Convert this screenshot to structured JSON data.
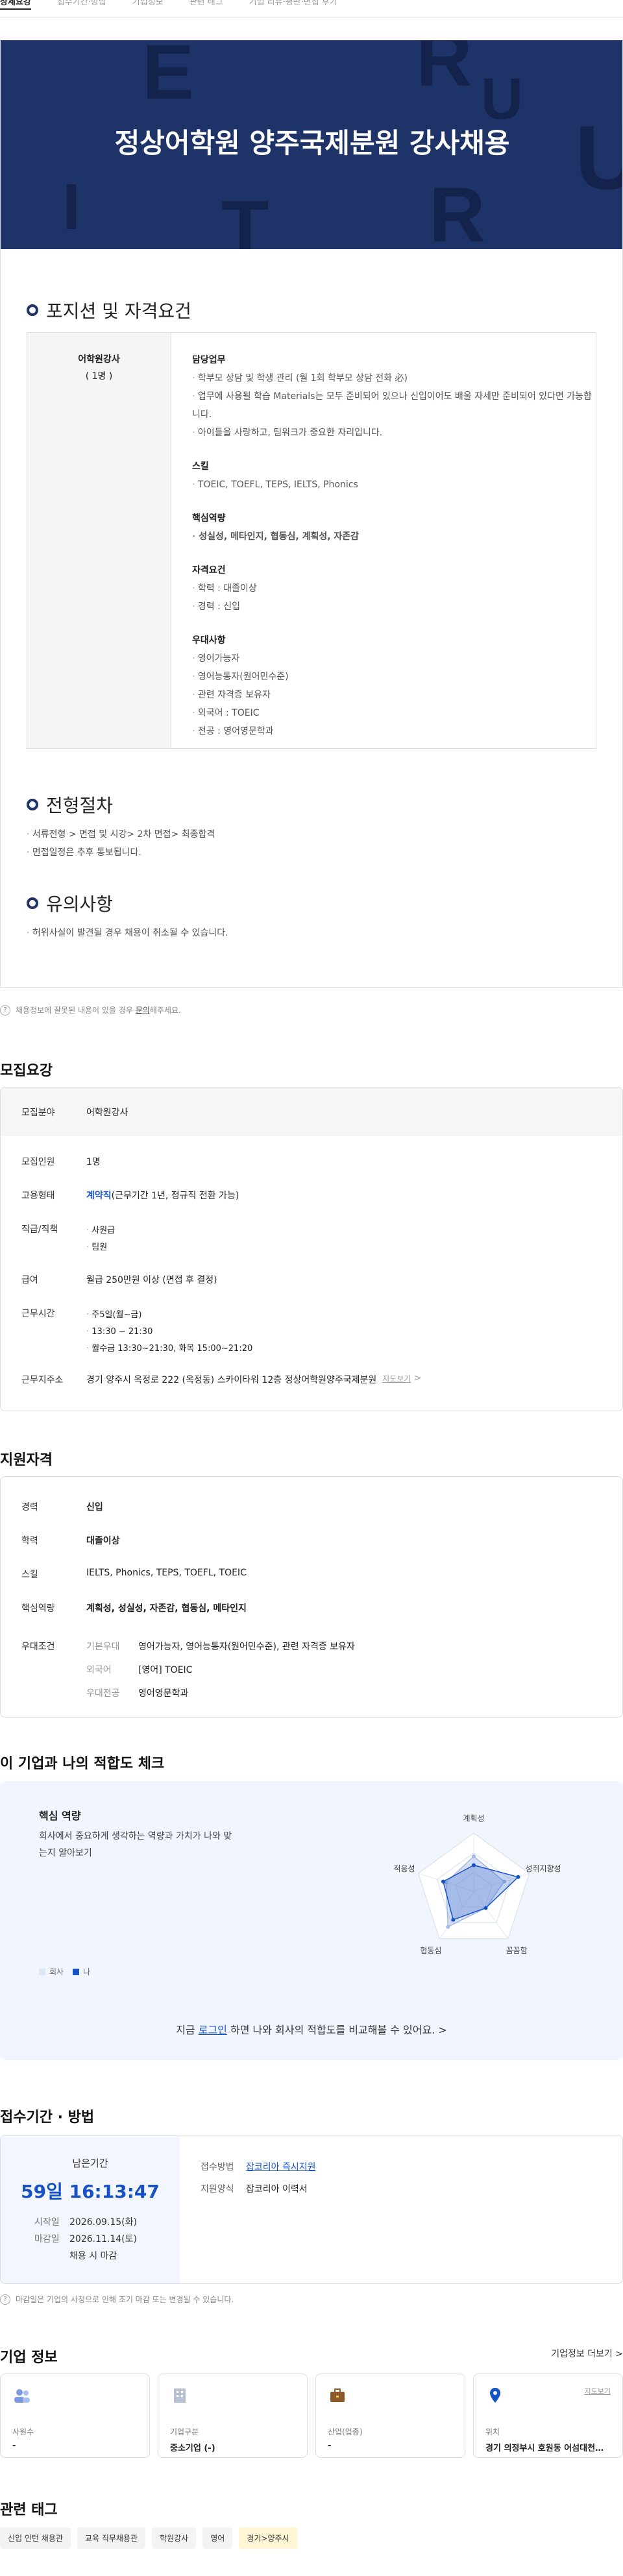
{
  "tabs": [
    "상세요강",
    "접수기간·방법",
    "기업정보",
    "관련 태그",
    "기업 리뷰·평판·면접 후기"
  ],
  "banner": {
    "title": "정상어학원 양주국제분원 강사채용",
    "letters": [
      "E",
      "R",
      "I",
      "T",
      "R",
      "U",
      "U"
    ]
  },
  "position": {
    "section_title": "포지션 및 자격요건",
    "role": "어학원강사",
    "count": "( 1명 )",
    "groups": [
      {
        "title": "담당업무",
        "items": [
          "학부모 상담 및 학생 관리 (월 1회 학부모 상담 전화 必)",
          "업무에 사용될 학습 Materials는 모두 준비되어 있으나 신입이어도 배울 자세만 준비되어 있다면 가능합니다.",
          "아이들을 사랑하고, 팀워크가 중요한 자리입니다."
        ]
      },
      {
        "title": "스킬",
        "items": [
          "TOEIC, TOEFL, TEPS, IELTS, Phonics"
        ]
      },
      {
        "title": "핵심역량",
        "items": [
          "성실성, 메타인지, 협동심, 계획성, 자존감"
        ],
        "bold": true
      },
      {
        "title": "자격요건",
        "items": [
          "학력 : 대졸이상",
          "경력 : 신입"
        ]
      },
      {
        "title": "우대사항",
        "items": [
          "영어가능자",
          "영어능통자(원어민수준)",
          "관련 자격증 보유자",
          "외국어 : TOEIC",
          "전공 : 영어영문학과"
        ]
      }
    ]
  },
  "process": {
    "title": "전형절차",
    "items": [
      "서류전형 > 면접 및 시강> 2차 면접> 최종합격",
      "면접일정은 추후 통보됩니다."
    ]
  },
  "caution": {
    "title": "유의사항",
    "items": [
      "허위사실이 발견될 경우 채용이 취소될 수 있습니다."
    ]
  },
  "note": {
    "text": "채용정보에 잘못된 내용이 있을 경우",
    "link": "문의",
    "suffix": "해주세요."
  },
  "recruit": {
    "title": "모집요강",
    "rows": [
      {
        "k": "모집분야",
        "v": "어학원강사"
      },
      {
        "k": "모집인원",
        "v": "1명"
      },
      {
        "k": "고용형태",
        "v": "계약직",
        "extra": "(근무기간 1년, 정규직 전환 가능)"
      },
      {
        "k": "직급/직책",
        "v": "사원급",
        "v2": "팀원"
      },
      {
        "k": "급여",
        "v": "월급 250만원 이상 (면접 후 결정)"
      },
      {
        "k": "근무시간",
        "v": "주5일(월~금)",
        "v2": "13:30 ~ 21:30",
        "v3": "월수금 13:30~21:30, 화목 15:00~21:20"
      },
      {
        "k": "근무지주소",
        "v": "경기 양주시 옥정로 222 (옥정동) 스카이타워 12층 정상어학원양주국제분원",
        "link": "지도보기"
      }
    ]
  },
  "qual": {
    "title": "지원자격",
    "rows": [
      {
        "k": "경력",
        "v": "신입"
      },
      {
        "k": "학력",
        "v": "대졸이상"
      },
      {
        "k": "스킬",
        "v": "IELTS, Phonics, TEPS, TOEFL, TOEIC"
      },
      {
        "k": "핵심역량",
        "v": "계획성, 성실성, 자존감, 협동심, 메타인지"
      },
      {
        "k": "우대조건",
        "sub": [
          {
            "k": "기본우대",
            "v": "영어가능자, 영어능통자(원어민수준), 관련 자격증 보유자"
          },
          {
            "k": "외국어",
            "v": "[영어] TOEIC"
          },
          {
            "k": "우대전공",
            "v": "영어영문학과"
          }
        ]
      }
    ]
  },
  "fit": {
    "title": "이 기업과 나의 적합도 체크",
    "card_title": "핵심 역량",
    "desc": "회사에서 중요하게 생각하는 역량과 가치가 나와 맞는지 알아보기",
    "axes": [
      "계획성",
      "성취지향성",
      "꼼꼼함",
      "협동심",
      "적응성"
    ],
    "company": [
      0.6,
      0.55,
      0.35,
      0.75,
      0.5
    ],
    "me": [
      0.45,
      0.8,
      0.35,
      0.6,
      0.55
    ],
    "legend_company": "회사",
    "legend_me": "나",
    "cta_pre": "지금",
    "cta_link": "로그인",
    "cta_post": "하면 나와 회사의 적합도를 비교해볼 수 있어요.",
    "accent": "#1652c5"
  },
  "period": {
    "title": "접수기간 · 방법",
    "remain_label": "남은기간",
    "remain": "59일 16:13:47",
    "start_k": "시작일",
    "start": "2026.09.15(화)",
    "end_k": "마감일",
    "end": "2026.11.14(토)",
    "end_note": "채용 시 마감",
    "method_k": "접수방법",
    "method": "잡코리아 즉시지원",
    "form_k": "지원양식",
    "form": "잡코리아 이력서",
    "note": "마감일은 기업의 사정으로 인해 조기 마감 또는 변경될 수 있습니다."
  },
  "company": {
    "title": "기업 정보",
    "more": "기업정보 더보기",
    "cards": [
      {
        "label": "사원수",
        "value": "-",
        "icon": "people-icon"
      },
      {
        "label": "기업구분",
        "value": "중소기업 (-)",
        "icon": "building-icon"
      },
      {
        "label": "산업(업종)",
        "value": "-",
        "icon": "briefcase-icon"
      },
      {
        "label": "위치",
        "value": "경기 의정부시 호원동 어섬대천로 4...",
        "icon": "pin-icon",
        "map": "지도보기"
      }
    ]
  },
  "tags": {
    "title": "관련 태그",
    "items": [
      "신입 인턴 채용관",
      "교육 직무채용관",
      "학원강사",
      "영어",
      "경기>양주시"
    ]
  }
}
